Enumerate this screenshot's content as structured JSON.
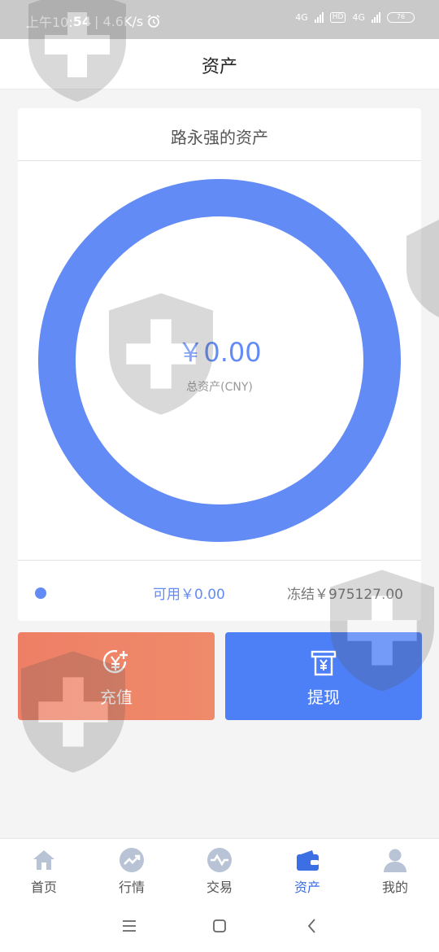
{
  "status_bar": {
    "time_prefix": "上午10:",
    "time_minutes": "54",
    "net_speed": "| 4.6K/s",
    "net_type_1": "4G",
    "hd": "HD",
    "net_type_2": "4G",
    "battery": "76"
  },
  "header": {
    "title": "资产"
  },
  "asset_card": {
    "title": "路永强的资产",
    "total_amount": "￥0.00",
    "total_label": "总资产(CNY)",
    "available": "可用￥0.00",
    "frozen": "冻结￥975127.00",
    "ring_color": "#638bf5"
  },
  "actions": {
    "recharge": {
      "label": "充值",
      "icon": "yuan-plus-icon"
    },
    "withdraw": {
      "label": "提现",
      "icon": "atm-withdraw-icon"
    }
  },
  "tabbar": {
    "items": [
      {
        "label": "首页",
        "icon": "home-icon",
        "active": false
      },
      {
        "label": "行情",
        "icon": "trend-icon",
        "active": false
      },
      {
        "label": "交易",
        "icon": "exchange-icon",
        "active": false
      },
      {
        "label": "资产",
        "icon": "wallet-icon",
        "active": true
      },
      {
        "label": "我的",
        "icon": "user-icon",
        "active": false
      }
    ],
    "active_color": "#3d6fe4"
  },
  "system_nav": {
    "icons": [
      "menu-icon",
      "home-square-icon",
      "back-icon"
    ]
  }
}
